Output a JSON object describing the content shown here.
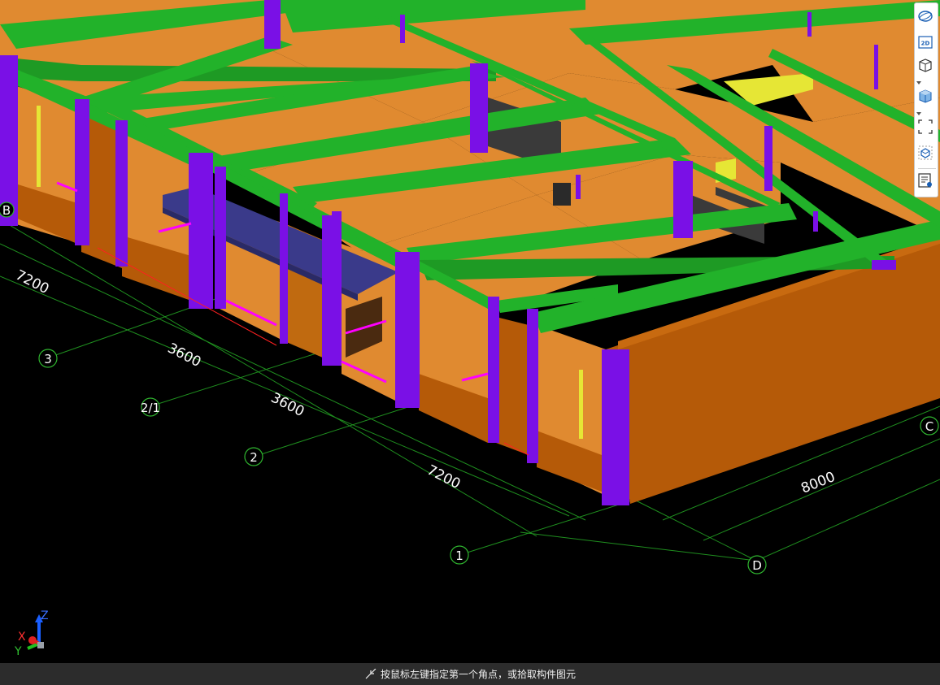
{
  "dimensions": {
    "d1": "7200",
    "d2": "3600",
    "d3": "3600",
    "d4": "7200",
    "d5": "8000"
  },
  "axes": {
    "a3": "3",
    "a21": "2/1",
    "a2": "2",
    "a1": "1",
    "aC": "C",
    "aD": "D",
    "aB": "B"
  },
  "triad": {
    "x": "X",
    "y": "Y",
    "z": "Z"
  },
  "toolbar": {
    "orbit": "orbit-icon",
    "view2d": "2D",
    "view3d": "cube-icon",
    "view3d_alt": "shaded-cube-icon",
    "zoom_extent": "zoom-extent-icon",
    "component": "component-view-icon",
    "properties": "properties-list-icon"
  },
  "status": {
    "message": "按鼠标左键指定第一个角点，或拾取构件图元"
  },
  "colors": {
    "wall": "#e08a30",
    "wall_dark": "#b55a08",
    "beam": "#22b22a",
    "column": "#7a10e6",
    "slab": "#3a3a8a",
    "grid": "#1f8f1f",
    "magenta": "#ff00ff",
    "yellow": "#e6e635"
  }
}
